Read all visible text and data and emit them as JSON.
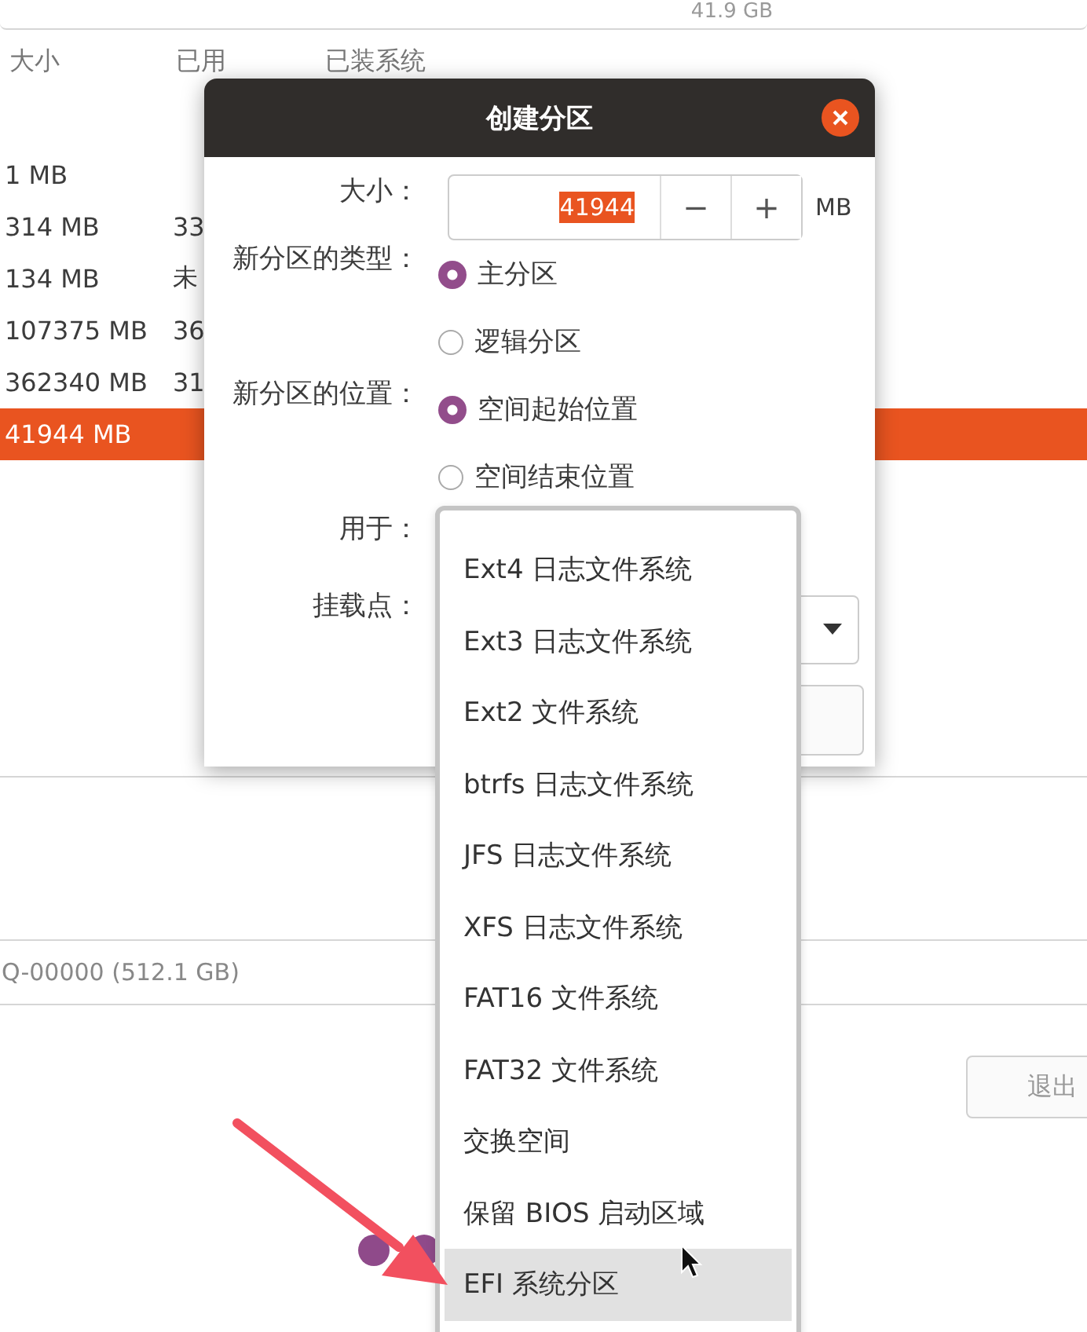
{
  "disk_bar": {
    "size_label": "41.9 GB"
  },
  "table": {
    "columns": [
      "大小",
      "已用",
      "已装系统"
    ],
    "rows": [
      {
        "size": "1 MB",
        "selected": false
      },
      {
        "size": "314 MB",
        "used": "33",
        "selected": false
      },
      {
        "size": "134 MB",
        "used": "未",
        "selected": false
      },
      {
        "size": "107375 MB",
        "used": "36",
        "selected": false
      },
      {
        "size": "362340 MB",
        "used": "31",
        "selected": false
      },
      {
        "size": "41944 MB",
        "selected": true
      }
    ]
  },
  "device": {
    "value": "Q-00000 (512.1 GB)"
  },
  "quit_button": {
    "label": "退出"
  },
  "dialog": {
    "title": "创建分区",
    "size": {
      "label": "大小：",
      "value": "41944",
      "minus": "−",
      "plus": "+",
      "unit": "MB"
    },
    "type": {
      "label": "新分区的类型：",
      "options": [
        {
          "label": "主分区",
          "selected": true
        },
        {
          "label": "逻辑分区",
          "selected": false
        }
      ]
    },
    "location": {
      "label": "新分区的位置：",
      "options": [
        {
          "label": "空间起始位置",
          "selected": true
        },
        {
          "label": "空间结束位置",
          "selected": false
        }
      ]
    },
    "use_for": {
      "label": "用于："
    },
    "mount_point": {
      "label": "挂载点："
    }
  },
  "menu": {
    "items": [
      {
        "label": "Ext4 日志文件系统",
        "selected": false
      },
      {
        "label": "Ext3 日志文件系统",
        "selected": false
      },
      {
        "label": "Ext2 文件系统",
        "selected": false
      },
      {
        "label": "btrfs 日志文件系统",
        "selected": false
      },
      {
        "label": "JFS 日志文件系统",
        "selected": false
      },
      {
        "label": "XFS 日志文件系统",
        "selected": false
      },
      {
        "label": "FAT16 文件系统",
        "selected": false
      },
      {
        "label": "FAT32 文件系统",
        "selected": false
      },
      {
        "label": "交换空间",
        "selected": false
      },
      {
        "label": "保留 BIOS 启动区域",
        "selected": false
      },
      {
        "label": "EFI 系统分区",
        "selected": true
      }
    ]
  }
}
